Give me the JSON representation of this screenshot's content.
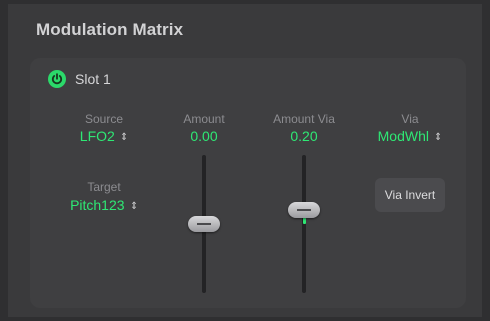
{
  "panel": {
    "title": "Modulation Matrix"
  },
  "slot": {
    "label": "Slot 1",
    "power_on": true,
    "source": {
      "label": "Source",
      "value": "LFO2"
    },
    "target": {
      "label": "Target",
      "value": "Pitch123"
    },
    "amount": {
      "label": "Amount",
      "value": "0.00",
      "level": 0.0
    },
    "amount_via": {
      "label": "Amount Via",
      "value": "0.20",
      "level": 0.2
    },
    "via": {
      "label": "Via",
      "value": "ModWhl"
    },
    "via_invert": {
      "label": "Via Invert"
    }
  },
  "colors": {
    "accent": "#2ee874",
    "power": "#2bd96a",
    "background": "#3a3a3c"
  },
  "icons": {
    "power": "power-icon",
    "stepper": "up-down-chevron-icon"
  }
}
